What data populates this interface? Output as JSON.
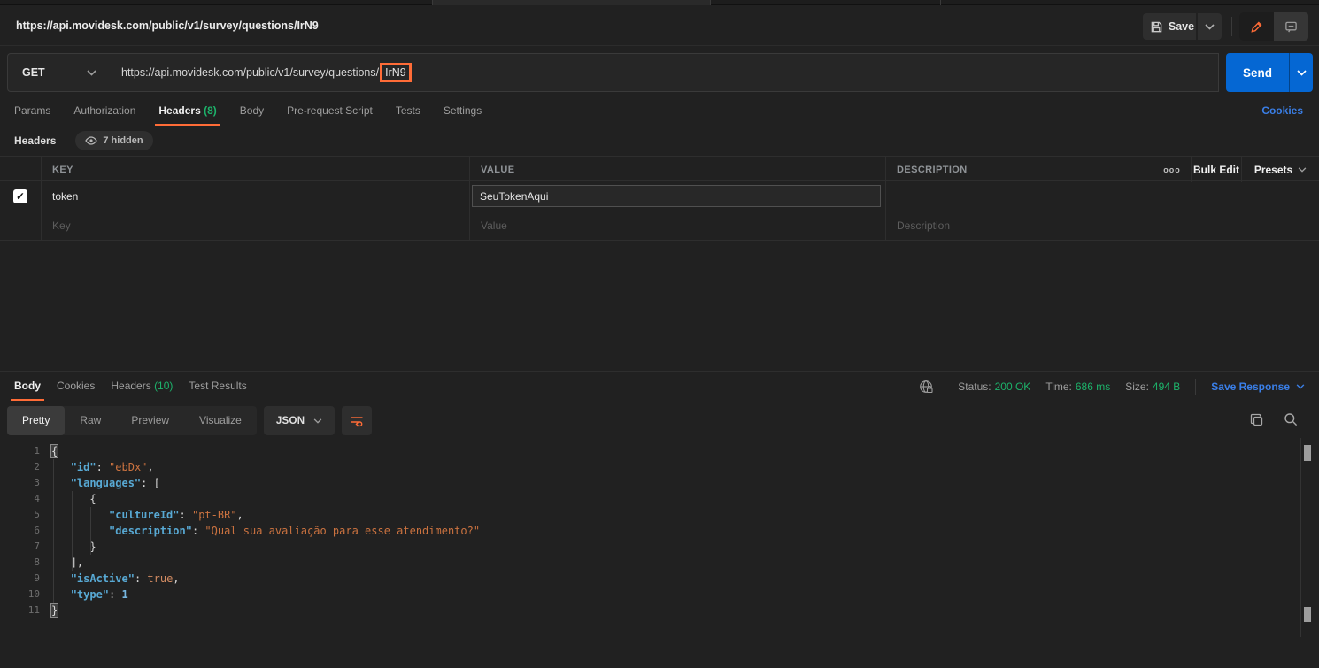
{
  "colors": {
    "accent_orange": "#ff6c37",
    "success_green": "#1db36b",
    "link_blue": "#3a7fe8",
    "send_blue": "#0567d3"
  },
  "titlebar": {
    "request_title": "https://api.movidesk.com/public/v1/survey/questions/IrN9",
    "save_label": "Save"
  },
  "request_bar": {
    "method": "GET",
    "url_prefix": "https://api.movidesk.com/public/v1/survey/questions/",
    "url_highlighted": "IrN9",
    "send_label": "Send"
  },
  "request_tabs": {
    "items": [
      {
        "label": "Params"
      },
      {
        "label": "Authorization"
      },
      {
        "label": "Headers",
        "count": "(8)"
      },
      {
        "label": "Body"
      },
      {
        "label": "Pre-request Script"
      },
      {
        "label": "Tests"
      },
      {
        "label": "Settings"
      }
    ],
    "cookies_link": "Cookies"
  },
  "headers_editor": {
    "title": "Headers",
    "hidden_badge": "7 hidden",
    "columns": {
      "key": "KEY",
      "value": "VALUE",
      "description": "DESCRIPTION"
    },
    "bulk_edit_label": "Bulk Edit",
    "presets_label": "Presets",
    "rows": [
      {
        "checked": true,
        "key": "token",
        "value": "SeuTokenAqui",
        "description": ""
      }
    ],
    "new_row_placeholders": {
      "key": "Key",
      "value": "Value",
      "description": "Description"
    }
  },
  "response": {
    "tabs": [
      {
        "label": "Body"
      },
      {
        "label": "Cookies"
      },
      {
        "label": "Headers",
        "count": "(10)"
      },
      {
        "label": "Test Results"
      }
    ],
    "status_label": "Status:",
    "status_value": "200 OK",
    "time_label": "Time:",
    "time_value": "686 ms",
    "size_label": "Size:",
    "size_value": "494 B",
    "save_response_label": "Save Response",
    "view_tabs": [
      "Pretty",
      "Raw",
      "Preview",
      "Visualize"
    ],
    "active_view": "Pretty",
    "format_select": "JSON"
  },
  "code": {
    "line_numbers": [
      1,
      2,
      3,
      4,
      5,
      6,
      7,
      8,
      9,
      10,
      11
    ],
    "lines": [
      [
        [
          "brace-hl",
          "{"
        ]
      ],
      [
        [
          "plain",
          "   "
        ],
        [
          "key",
          "\"id\""
        ],
        [
          "punct",
          ": "
        ],
        [
          "str",
          "\"ebDx\""
        ],
        [
          "punct",
          ","
        ]
      ],
      [
        [
          "plain",
          "   "
        ],
        [
          "key",
          "\"languages\""
        ],
        [
          "punct",
          ": ["
        ]
      ],
      [
        [
          "plain",
          "      "
        ],
        [
          "punct",
          "{"
        ]
      ],
      [
        [
          "plain",
          "         "
        ],
        [
          "key",
          "\"cultureId\""
        ],
        [
          "punct",
          ": "
        ],
        [
          "str",
          "\"pt-BR\""
        ],
        [
          "punct",
          ","
        ]
      ],
      [
        [
          "plain",
          "         "
        ],
        [
          "key",
          "\"description\""
        ],
        [
          "punct",
          ": "
        ],
        [
          "str",
          "\"Qual sua avaliação para esse atendimento?\""
        ]
      ],
      [
        [
          "plain",
          "      "
        ],
        [
          "punct",
          "}"
        ]
      ],
      [
        [
          "plain",
          "   "
        ],
        [
          "punct",
          "],"
        ]
      ],
      [
        [
          "plain",
          "   "
        ],
        [
          "key",
          "\"isActive\""
        ],
        [
          "punct",
          ": "
        ],
        [
          "bool",
          "true"
        ],
        [
          "punct",
          ","
        ]
      ],
      [
        [
          "plain",
          "   "
        ],
        [
          "key",
          "\"type\""
        ],
        [
          "punct",
          ": "
        ],
        [
          "num",
          "1"
        ]
      ],
      [
        [
          "brace-hl",
          "}"
        ]
      ]
    ]
  }
}
